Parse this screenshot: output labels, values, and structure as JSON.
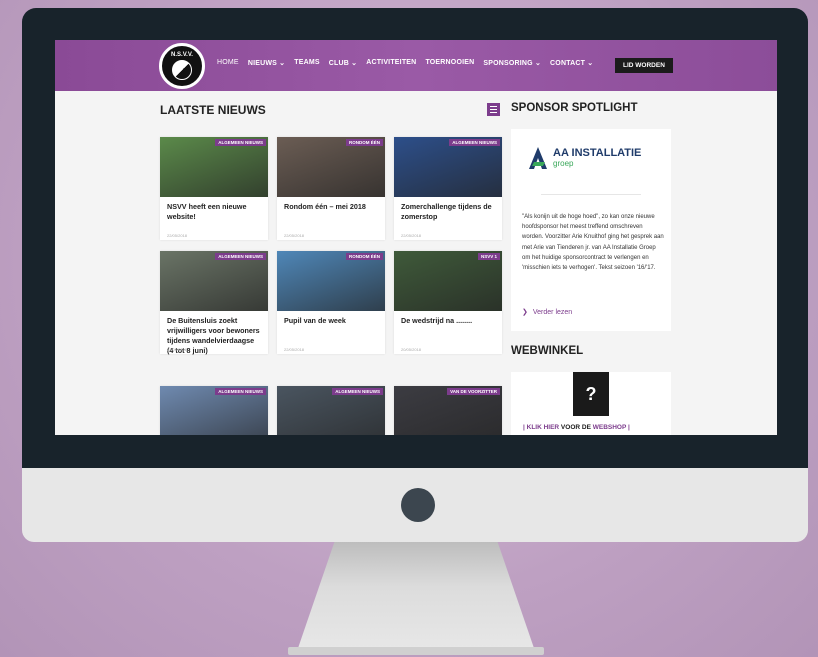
{
  "nav": {
    "logo_text": "N.S.V.V.",
    "items": [
      "HOME",
      "NIEUWS ⌄",
      "TEAMS",
      "CLUB ⌄",
      "ACTIVITEITEN",
      "TOERNOOIEN",
      "SPONSORING ⌄",
      "CONTACT ⌄"
    ],
    "join_label": "LID WORDEN"
  },
  "news": {
    "heading": "LAATSTE NIEUWS",
    "cards": [
      {
        "tag": "ALGEMEEN NIEUWS",
        "title": "NSVV heeft een nieuwe website!",
        "date": "22/05/2018",
        "img_color": "#5b8a4a"
      },
      {
        "tag": "RONDOM ÉÉN",
        "title": "Rondom één – mei 2018",
        "date": "22/05/2018",
        "img_color": "#6b5d54"
      },
      {
        "tag": "ALGEMEEN NIEUWS",
        "title": "Zomerchallenge tijdens de zomerstop",
        "date": "22/05/2018",
        "img_color": "#2d4f8a"
      },
      {
        "tag": "ALGEMEEN NIEUWS",
        "title": "De Buitensluis zoekt vrijwilligers voor bewoners tijdens wandelvierdaagse (4 tot 8 juni)",
        "date": "22/05/2018",
        "img_color": "#6a7466"
      },
      {
        "tag": "RONDOM ÉÉN",
        "title": "Pupil van de week",
        "date": "22/05/2018",
        "img_color": "#4f87b8"
      },
      {
        "tag": "NSVV 1",
        "title": "De wedstrijd na ........",
        "date": "20/05/2018",
        "img_color": "#3f5a3a"
      },
      {
        "tag": "ALGEMEEN NIEUWS",
        "title": "",
        "date": "",
        "img_color": "#6f8ab0"
      },
      {
        "tag": "ALGEMEEN NIEUWS",
        "title": "",
        "date": "",
        "img_color": "#4a5560"
      },
      {
        "tag": "VAN DE VOORZITTER",
        "title": "",
        "date": "",
        "img_color": "#3c3c42"
      }
    ]
  },
  "sponsor": {
    "heading": "SPONSOR SPOTLIGHT",
    "logo_name": "AA INSTALLATIE",
    "logo_sub": "groep",
    "text": "\"Als konijn uit de hoge hoed\", zo kan onze nieuwe hoofdsponsor het meest treffend omschreven worden. Voorzitter Arie Knuithof ging het gesprek aan met Arie van Tienderen jr. van AA Installatie Groep om het huidige sponsorcontract te verlengen en 'misschien iets te verhogen'. Tekst seizoen '16/'17.",
    "more_label": "Verder lezen"
  },
  "shop": {
    "heading": "WEBWINKEL",
    "logo_glyph": "?",
    "link_label_a": "| KLIK HIER",
    "link_label_b": " VOOR DE ",
    "link_label_c": "WEBSHOP |"
  },
  "colors": {
    "accent": "#7c3c8c",
    "nav": "#8a4a96",
    "bezel": "#18232b"
  }
}
